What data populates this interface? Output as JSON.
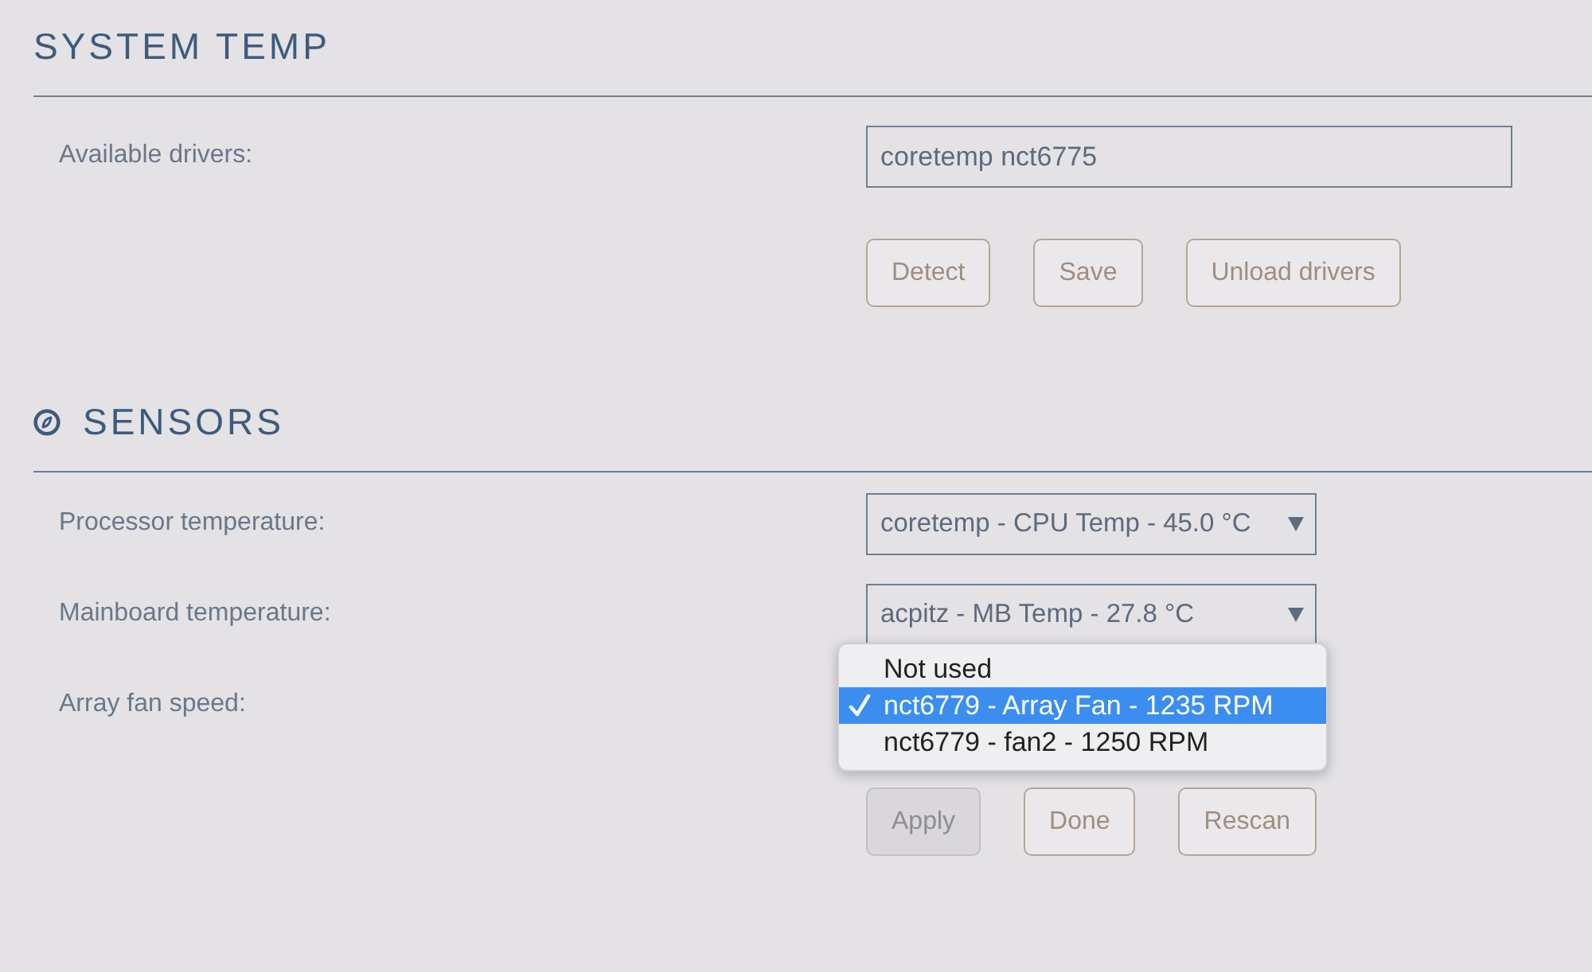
{
  "sections": [
    {
      "title": "SYSTEM TEMP",
      "icon": false,
      "rows": [
        {
          "kind": "text",
          "label": "Available drivers:",
          "value": "coretemp nct6775"
        }
      ],
      "buttons": [
        {
          "label": "Detect",
          "disabled": false
        },
        {
          "label": "Save",
          "disabled": false
        },
        {
          "label": "Unload drivers",
          "disabled": false
        }
      ]
    },
    {
      "title": "SENSORS",
      "icon": true,
      "rows": [
        {
          "kind": "select",
          "label": "Processor temperature:",
          "value": "coretemp - CPU Temp - 45.0 °C"
        },
        {
          "kind": "select",
          "label": "Mainboard temperature:",
          "value": "acpitz - MB Temp - 27.8 °C"
        },
        {
          "kind": "menu",
          "label": "Array fan speed:",
          "options": [
            {
              "label": "Not used",
              "selected": false
            },
            {
              "label": "nct6779 - Array Fan - 1235 RPM",
              "selected": true
            },
            {
              "label": "nct6779 - fan2 - 1250 RPM",
              "selected": false
            }
          ]
        }
      ],
      "buttons": [
        {
          "label": "Apply",
          "disabled": true
        },
        {
          "label": "Done",
          "disabled": false
        },
        {
          "label": "Rescan",
          "disabled": false
        }
      ]
    }
  ]
}
